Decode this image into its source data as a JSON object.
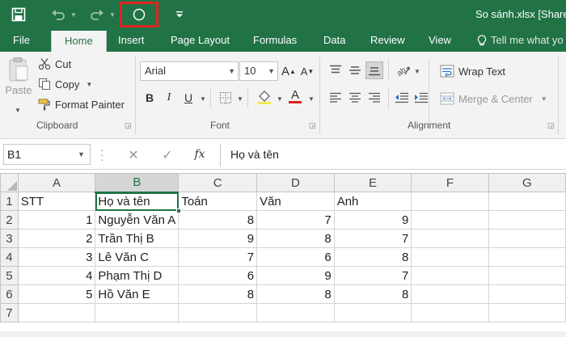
{
  "title_bar": {
    "document_title": "So sánh.xlsx  [Share",
    "quick_access": {
      "save_icon": "save-icon",
      "undo_icon": "undo-icon",
      "redo_icon": "redo-icon",
      "circle_icon": "circle-icon",
      "customize_icon": "customize-toolbar-icon"
    },
    "highlight_color": "#e02222"
  },
  "tabs": [
    {
      "label": "File"
    },
    {
      "label": "Home",
      "active": true
    },
    {
      "label": "Insert"
    },
    {
      "label": "Page Layout"
    },
    {
      "label": "Formulas"
    },
    {
      "label": "Data"
    },
    {
      "label": "Review"
    },
    {
      "label": "View"
    },
    {
      "label": "Tell me what yo"
    }
  ],
  "ribbon": {
    "clipboard": {
      "label": "Clipboard",
      "paste": "Paste",
      "cut": "Cut",
      "copy": "Copy",
      "format_painter": "Format Painter"
    },
    "font": {
      "label": "Font",
      "font_name": "Arial",
      "font_size": "10",
      "bold": "B",
      "italic": "I",
      "underline": "U",
      "grow": "A",
      "shrink": "A",
      "font_color_letter": "A",
      "highlight_color": "#f5e74c",
      "font_color": "#e02222"
    },
    "alignment": {
      "label": "Alignment",
      "wrap_text": "Wrap Text",
      "merge_center": "Merge & Center"
    }
  },
  "formula_bar": {
    "name_box": "B1",
    "cancel": "✕",
    "enter": "✓",
    "fx": "fx",
    "content": "Họ và tên"
  },
  "sheet": {
    "columns": [
      "A",
      "B",
      "C",
      "D",
      "E",
      "F",
      "G"
    ],
    "selected_column": "B",
    "active_cell": "B1",
    "rows": [
      {
        "n": "1",
        "cells": [
          "STT",
          "Họ và tên",
          "Toán",
          "Văn",
          "Anh",
          "",
          ""
        ]
      },
      {
        "n": "2",
        "cells": [
          "1",
          "Nguyễn Văn A",
          "8",
          "7",
          "9",
          "",
          ""
        ]
      },
      {
        "n": "3",
        "cells": [
          "2",
          "Trần Thị B",
          "9",
          "8",
          "7",
          "",
          ""
        ]
      },
      {
        "n": "4",
        "cells": [
          "3",
          "Lê Văn C",
          "7",
          "6",
          "8",
          "",
          ""
        ]
      },
      {
        "n": "5",
        "cells": [
          "4",
          "Phạm Thị D",
          "6",
          "9",
          "7",
          "",
          ""
        ]
      },
      {
        "n": "6",
        "cells": [
          "5",
          "Hồ Văn E",
          "8",
          "8",
          "8",
          "",
          ""
        ]
      },
      {
        "n": "7",
        "cells": [
          "",
          "",
          "",
          "",
          "",
          "",
          ""
        ]
      }
    ],
    "accent_color": "#217346"
  }
}
